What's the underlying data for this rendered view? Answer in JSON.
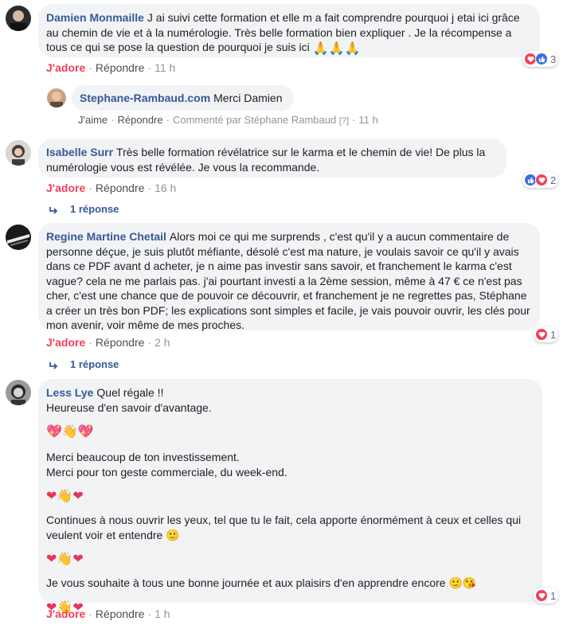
{
  "colors": {
    "author": "#385898",
    "love": "#f33e58",
    "like": "#3b6fe0",
    "bubble": "#f2f3f5",
    "muted": "#90949c"
  },
  "comments": [
    {
      "author": "Damien Monmaille",
      "text": "J ai suivi cette formation et elle m a fait comprendre pourquoi j etai ici grâce au chemin de vie et à la numérologie. Très belle formation bien expliquer . Je la récompense a tous ce qui se pose la question de pourquoi je suis ici",
      "emoji": "🙏🙏🙏",
      "reaction_label": "J'adore",
      "reply_label": "Répondre",
      "time": "11 h",
      "reaction_count": "3",
      "reaction_icons": [
        "love-icon",
        "like-icon"
      ]
    },
    {
      "author": "Isabelle Surr",
      "text": "Très belle formation révélatrice sur le karma et le chemin de vie! De plus la numérologie vous est révélée. Je vous la recommande.",
      "reaction_label": "J'adore",
      "reply_label": "Répondre",
      "time": "16 h",
      "reaction_count": "2",
      "reaction_icons": [
        "like-icon",
        "love-icon"
      ],
      "replies_label": "1 réponse"
    },
    {
      "author": "Regine Martine Chetail",
      "text": "Alors moi ce qui me surprends , c'est qu'il y a aucun commentaire de personne déçue, je suis plutôt méfiante, désolé c'est ma nature, je voulais savoir ce qu'il y avais dans ce PDF avant d acheter, je n aime pas investir sans savoir, et franchement le karma c'est vague? cela ne me parlais pas. j'ai pourtant investi a la 2ème session, même à 47 € ce n'est pas cher, c'est une chance que de pouvoir ce découvrir, et franchement je ne regrettes pas, Stéphane a créer un très bon PDF; les explications sont simples et facile, je vais pouvoir ouvrir, les clés pour mon avenir, voir même de mes proches.",
      "reaction_label": "J'adore",
      "reply_label": "Répondre",
      "time": "2 h",
      "reaction_count": "1",
      "reaction_icons": [
        "love-icon"
      ],
      "replies_label": "1 réponse"
    },
    {
      "author": "Less Lye",
      "lines": [
        "Quel régale !!",
        "Heureuse d'en savoir d'avantage.",
        "💖👋💖",
        "Merci beaucoup de ton investissement.",
        "Merci pour ton geste commerciale, du week-end.",
        "❤👋❤",
        "Continues à nous ouvrir les yeux, tel que tu le fait, cela apporte énormément à ceux et celles qui veulent voir et entendre 🙂",
        "❤👋❤",
        "Je vous souhaite à tous une bonne journée et aux plaisirs d'en apprendre encore 🙂😘",
        "❤👋❤"
      ],
      "reaction_label": "J'adore",
      "reply_label": "Répondre",
      "time": "1 h",
      "reaction_count": "1",
      "reaction_icons": [
        "love-icon"
      ]
    }
  ],
  "reply": {
    "author": "Stephane-Rambaud.com",
    "text": "Merci Damien",
    "like_label": "J'aime",
    "reply_label": "Répondre",
    "commented_by": "Commenté par Stéphane Rambaud",
    "help": "[?]",
    "time": "11 h"
  }
}
